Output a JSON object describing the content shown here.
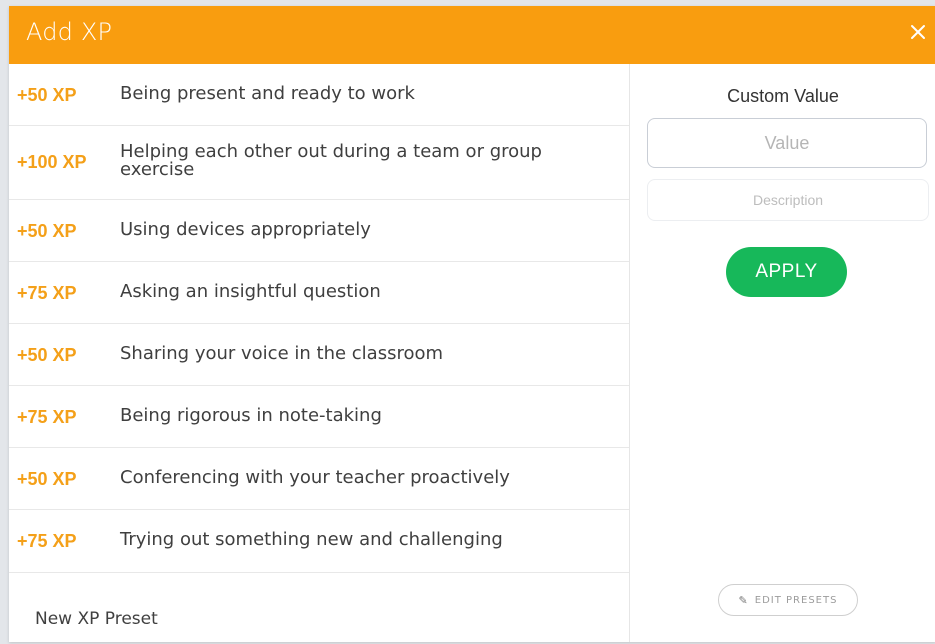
{
  "modal": {
    "title": "Add XP",
    "close_icon": "close-icon",
    "accent_color": "#f99d0f"
  },
  "presets": [
    {
      "xp": "+50 XP",
      "description": "Being present and ready to work"
    },
    {
      "xp": "+100 XP",
      "description": "Helping each other out during a team or group exercise"
    },
    {
      "xp": "+50 XP",
      "description": "Using devices appropriately"
    },
    {
      "xp": "+75 XP",
      "description": "Asking an insightful question"
    },
    {
      "xp": "+50 XP",
      "description": "Sharing your voice in the classroom"
    },
    {
      "xp": "+75 XP",
      "description": "Being rigorous in note-taking"
    },
    {
      "xp": "+50 XP",
      "description": "Conferencing with your teacher proactively"
    },
    {
      "xp": "+75 XP",
      "description": "Trying out something new and challenging"
    }
  ],
  "new_preset": {
    "label": "New XP Preset"
  },
  "custom": {
    "label": "Custom Value",
    "value_placeholder": "Value",
    "description_placeholder": "Description",
    "apply_label": "APPLY",
    "apply_color": "#17b85a"
  },
  "edit_presets": {
    "label": "EDIT PRESETS",
    "icon": "pencil-icon"
  }
}
